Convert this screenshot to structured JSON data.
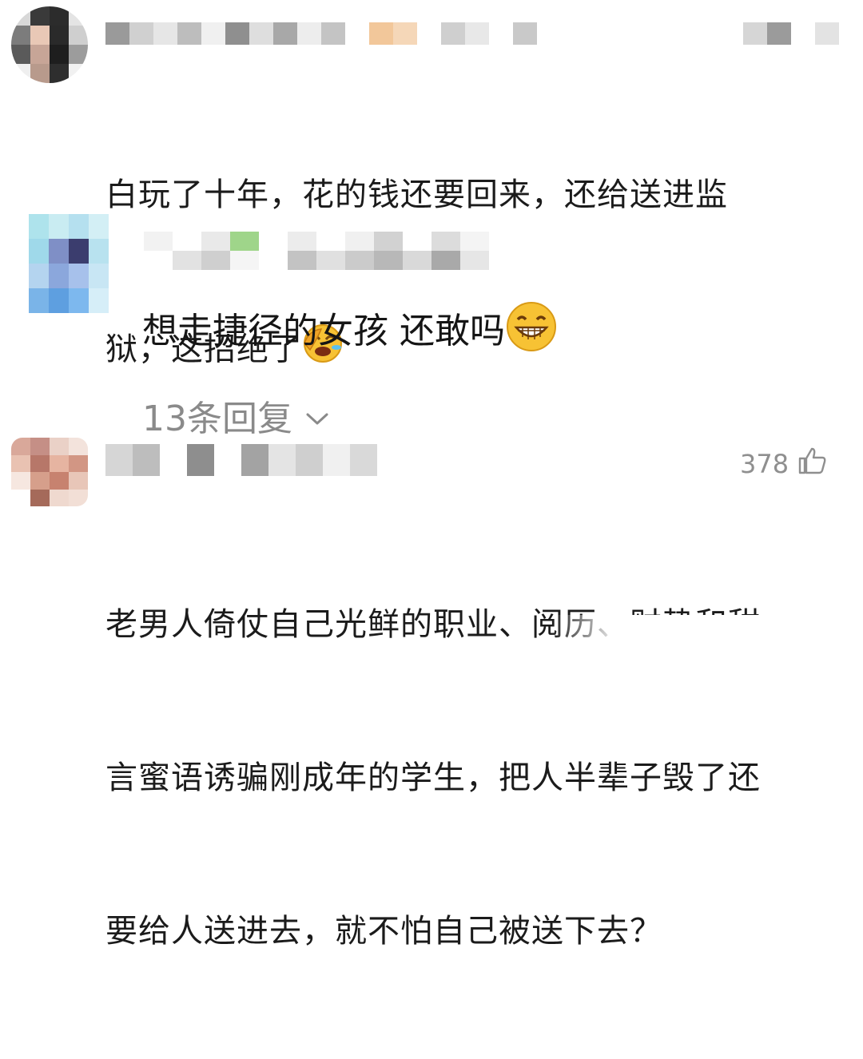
{
  "comments": [
    {
      "text_line1": "白玩了十年，花的钱还要回来，还给送进监",
      "text_line2": "狱，这招绝了",
      "emoji": "facepalm-laughing-emoji"
    },
    {
      "text": "想走捷径的女孩 还敢吗",
      "emoji": "grinning-emoji",
      "replies_label": "13条回复",
      "replies_icon": "chevron-down-icon"
    },
    {
      "like_count": "378",
      "like_icon": "thumbs-up-icon",
      "text_line1": "老男人倚仗自己光鲜的职业、阅历、财势和甜",
      "text_line2": "言蜜语诱骗刚成年的学生，把人半辈子毁了还",
      "text_line3": "要给人送进去，就不怕自己被送下去？"
    }
  ],
  "colors": {
    "text": "#1b1b1b",
    "muted": "#8a8a8a",
    "background": "#ffffff",
    "emoji_yellow": "#f7c234"
  }
}
